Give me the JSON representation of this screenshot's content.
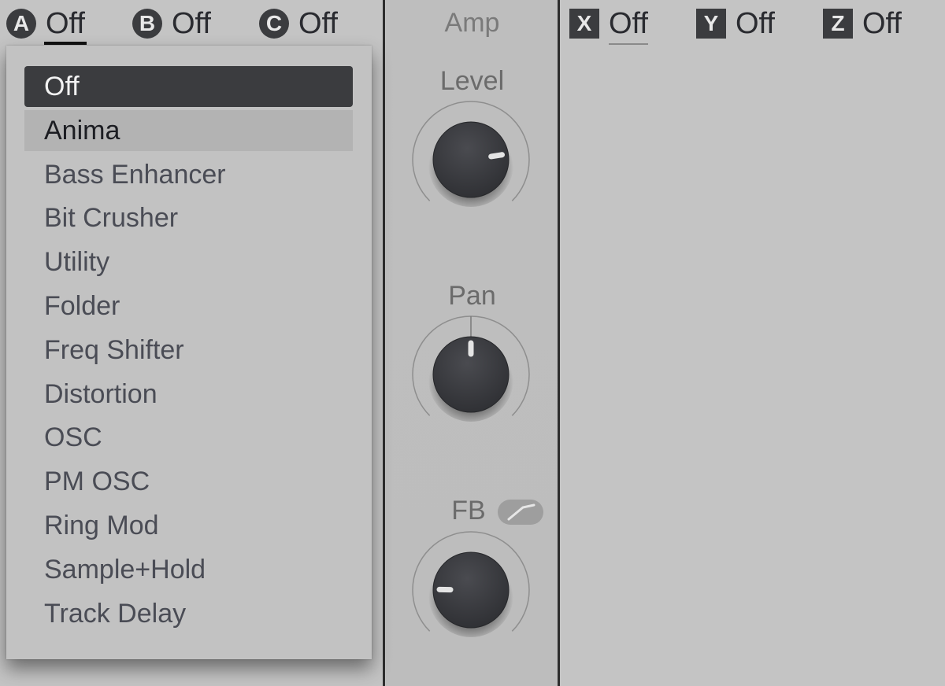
{
  "left_slots": [
    {
      "badge": "A",
      "value": "Off",
      "active": true
    },
    {
      "badge": "B",
      "value": "Off",
      "active": false
    },
    {
      "badge": "C",
      "value": "Off",
      "active": false
    }
  ],
  "right_slots": [
    {
      "badge": "X",
      "value": "Off",
      "active": true
    },
    {
      "badge": "Y",
      "value": "Off",
      "active": false
    },
    {
      "badge": "Z",
      "value": "Off",
      "active": false
    }
  ],
  "amp": {
    "title": "Amp",
    "level": {
      "label": "Level",
      "value_fraction": 0.8
    },
    "pan": {
      "label": "Pan",
      "value_fraction": 0.5,
      "bipolar": true
    },
    "fb": {
      "label": "FB",
      "value_fraction": 0.17,
      "toggle_icon": "curve-icon"
    }
  },
  "effect_menu": {
    "selected": "Off",
    "hovered": "Anima",
    "items": [
      "Off",
      "Anima",
      "Bass Enhancer",
      "Bit Crusher",
      "Utility",
      "Folder",
      "Freq Shifter",
      "Distortion",
      "OSC",
      "PM OSC",
      "Ring Mod",
      "Sample+Hold",
      "Track Delay"
    ]
  }
}
